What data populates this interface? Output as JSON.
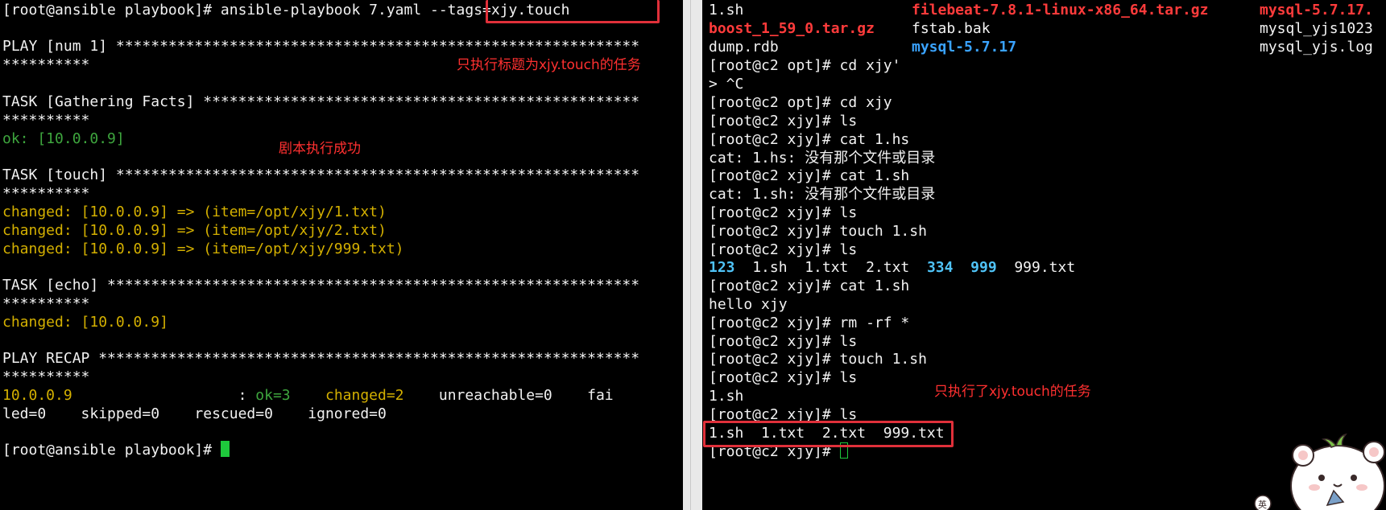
{
  "left_terminal": {
    "prompt_cmd": "[root@ansible playbook]# ansible-playbook 7.yaml --tags=xjy.touch",
    "play_header": "PLAY [num 1] ************************************************************",
    "stars_1": "**********",
    "task_gather": "TASK [Gathering Facts] **************************************************",
    "stars_2": "**********",
    "ok_line": "ok: [10.0.0.9]",
    "task_touch": "TASK [touch] ************************************************************",
    "stars_3": "**********",
    "changed_1": "changed: [10.0.0.9] => (item=/opt/xjy/1.txt)",
    "changed_2": "changed: [10.0.0.9] => (item=/opt/xjy/2.txt)",
    "changed_3": "changed: [10.0.0.9] => (item=/opt/xjy/999.txt)",
    "task_echo": "TASK [echo] *************************************************************",
    "stars_4": "**********",
    "changed_echo": "changed: [10.0.0.9]",
    "recap_header": "PLAY RECAP **************************************************************",
    "stars_5": "**********",
    "recap_host": "10.0.0.9",
    "recap_colon": "                   : ",
    "recap_ok": "ok=3",
    "recap_changed": "    changed=2",
    "recap_rest": "    unreachable=0    fai",
    "recap_line2": "led=0    skipped=0    rescued=0    ignored=0",
    "final_prompt": "[root@ansible playbook]# "
  },
  "left_notes": {
    "note_tags": "只执行标题为xjy.touch的任务",
    "note_success": "剧本执行成功"
  },
  "right_terminal": {
    "ls_row1": {
      "a": "1.sh",
      "b": "filebeat-7.8.1-linux-x86_64.tar.gz",
      "c": "mysql-5.7.17."
    },
    "ls_row2": {
      "a": "boost_1_59_0.tar.gz",
      "b": "fstab.bak",
      "c": "mysql_yjs1023"
    },
    "ls_row3": {
      "a": "dump.rdb",
      "b": "mysql-5.7.17",
      "c": "mysql_yjs.log"
    },
    "l4": "[root@c2 opt]# cd xjy'",
    "l5": "> ^C",
    "l6": "[root@c2 opt]# cd xjy",
    "l7": "[root@c2 xjy]# ls",
    "l8": "[root@c2 xjy]# cat 1.hs",
    "l9": "cat: 1.hs: 没有那个文件或目录",
    "l10": "[root@c2 xjy]# cat 1.sh",
    "l11": "cat: 1.sh: 没有那个文件或目录",
    "l12": "[root@c2 xjy]# ls",
    "l13": "[root@c2 xjy]# touch 1.sh",
    "l14": "[root@c2 xjy]# ls",
    "ls_items": {
      "d1": "123",
      "f1": "  1.sh  1.txt  2.txt  ",
      "d2": "334",
      "sp": "  ",
      "d3": "999",
      "f2": "  999.txt"
    },
    "l16": "[root@c2 xjy]# cat 1.sh",
    "l17": "hello xjy",
    "l18": "[root@c2 xjy]# rm -rf *",
    "l19": "[root@c2 xjy]# ls",
    "l20": "[root@c2 xjy]# touch 1.sh",
    "l21": "[root@c2 xjy]# ls",
    "l22": "1.sh",
    "l23": "[root@c2 xjy]# ls",
    "l24": "1.sh  1.txt  2.txt  999.txt",
    "final_prompt": "[root@c2 xjy]# "
  },
  "right_notes": {
    "note_only": "只执行了xjy.touch的任务"
  },
  "colors": {
    "highlight_box": "#e0303a",
    "ok_green": "#3ea63e",
    "changed_yellow": "#d4b000",
    "archive_red": "#ff3b3b",
    "dir_blue": "#3aa3ff"
  },
  "icons": {
    "cursor": "terminal-cursor",
    "mascot": "cartoon-bear-mascot"
  }
}
